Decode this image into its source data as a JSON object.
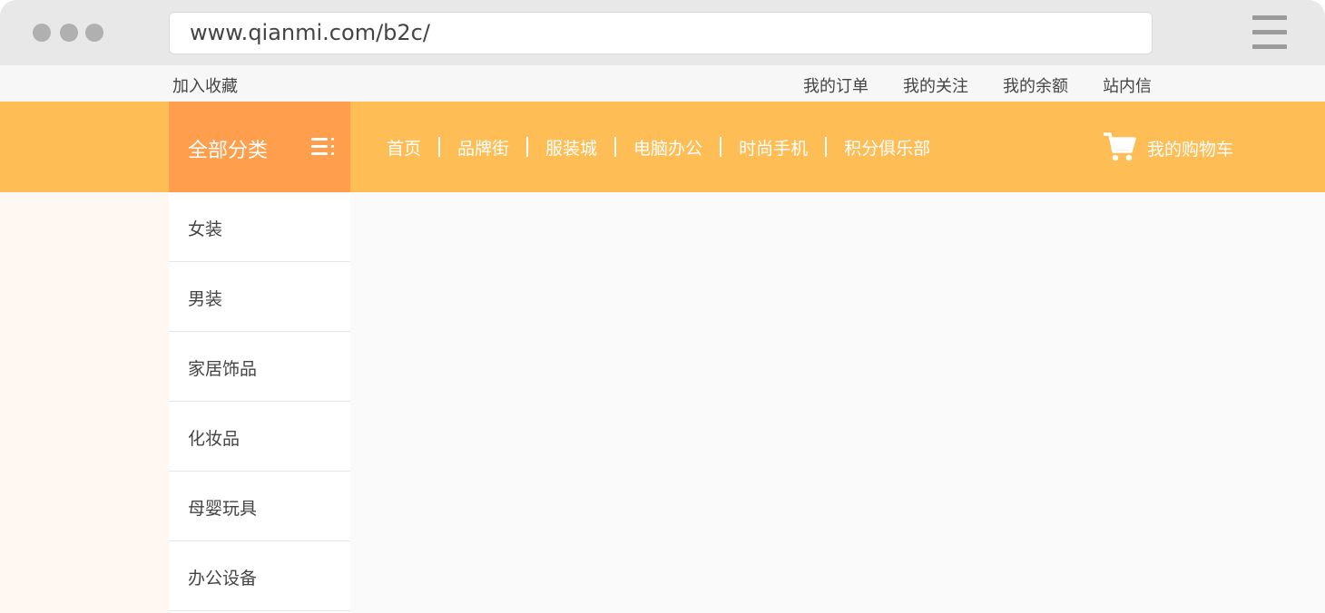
{
  "browser": {
    "url": "www.qianmi.com/b2c/"
  },
  "topbar": {
    "favorite": "加入收藏",
    "links": [
      "我的订单",
      "我的关注",
      "我的余额",
      "站内信"
    ]
  },
  "nav": {
    "all_categories": "全部分类",
    "links": [
      "首页",
      "品牌街",
      "服装城",
      "电脑办公",
      "时尚手机",
      "积分俱乐部"
    ],
    "cart": "我的购物车"
  },
  "sidebar": {
    "categories": [
      "女装",
      "男装",
      "家居饰品",
      "化妆品",
      "母婴玩具",
      "办公设备"
    ]
  },
  "colors": {
    "nav_bg": "#ffbd56",
    "all_categories_bg": "#ff9f4d",
    "chrome_bg": "#e8e8e8"
  }
}
